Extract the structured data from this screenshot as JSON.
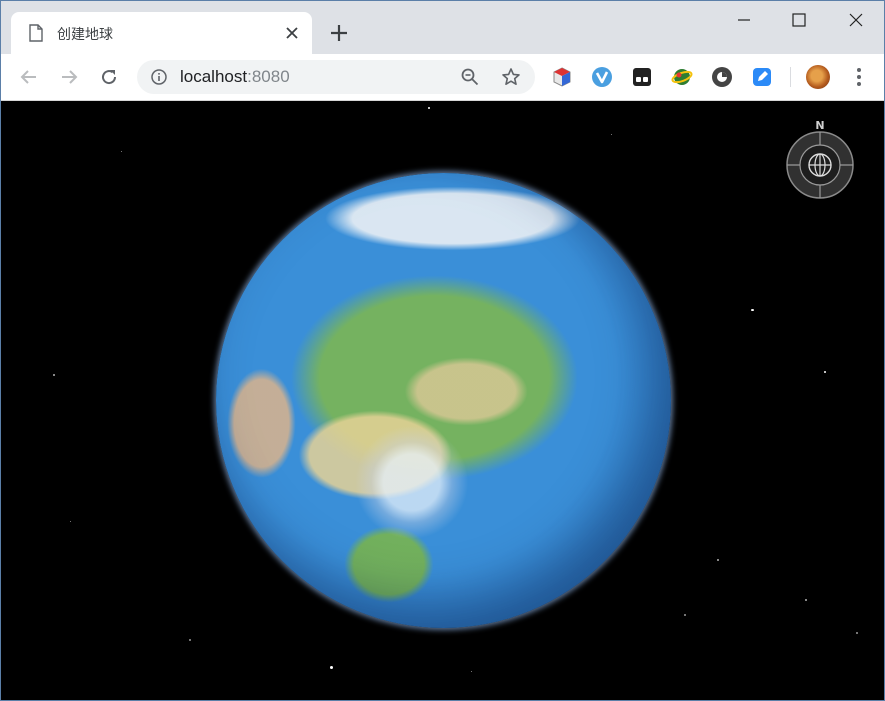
{
  "tab": {
    "title": "创建地球",
    "close_icon": "close-icon",
    "page_icon": "page-icon"
  },
  "newtab": {
    "icon": "plus-icon"
  },
  "window_controls": {
    "minimize": "minimize-icon",
    "maximize": "maximize-icon",
    "close": "close-icon"
  },
  "toolbar": {
    "back_icon": "back-arrow-icon",
    "forward_icon": "forward-arrow-icon",
    "reload_icon": "reload-icon",
    "omnibox": {
      "host": "localhost",
      "port": ":8080",
      "info_icon": "info-icon",
      "zoom_icon": "zoom-out-icon",
      "bookmark_icon": "star-icon"
    },
    "extensions": [
      "cube-extension-icon",
      "v-extension-icon",
      "dark-extension-icon",
      "globe-extension-icon",
      "circle-extension-icon",
      "pen-extension-icon"
    ],
    "menu_icon": "kebab-menu-icon"
  },
  "viewer": {
    "compass_label": "N",
    "colors": {
      "ocean": "#2c6fb8",
      "background": "#000000"
    }
  }
}
